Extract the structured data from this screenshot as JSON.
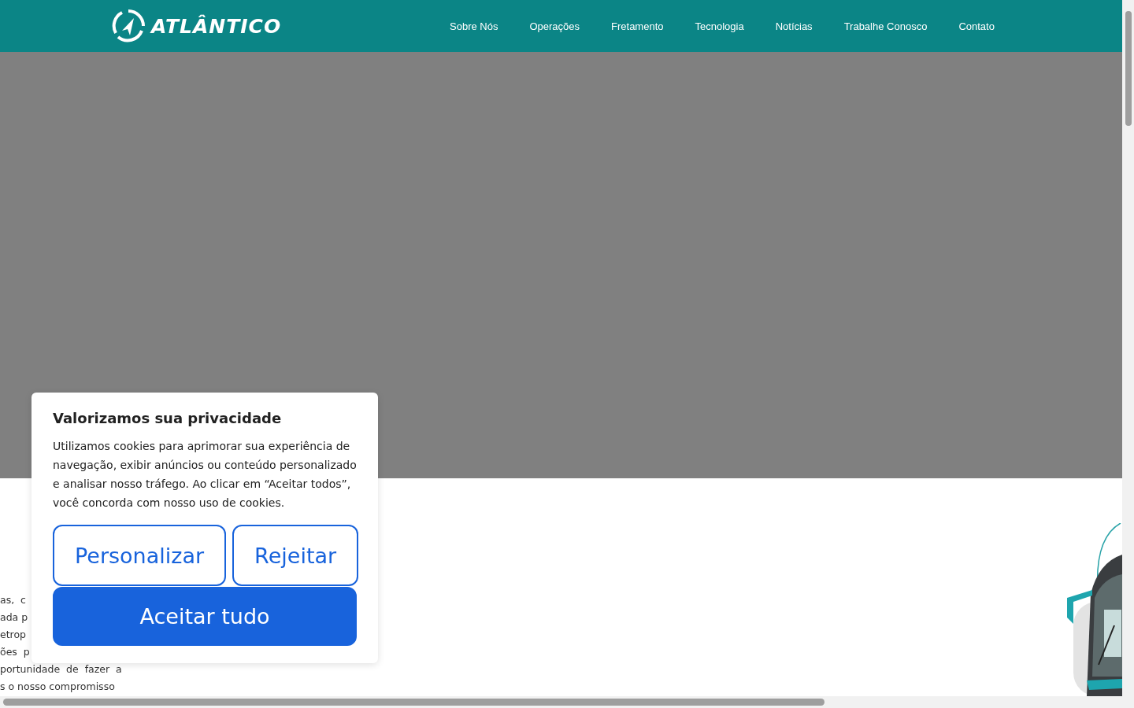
{
  "header": {
    "logo": "ATLÂNTICO",
    "nav": [
      "Sobre Nós",
      "Operações",
      "Fretamento",
      "Tecnologia",
      "Notícias",
      "Trabalhe Conosco",
      "Contato"
    ]
  },
  "hero": {
    "kind": "empty"
  },
  "intro": {
    "lines": [
      "as,  c",
      "ada p",
      "etrop",
      "ões  p",
      "portunidade  de  fazer  a",
      "s o nosso compromisso"
    ],
    "image": {
      "kind": "picture"
    }
  },
  "cookie_banner": {
    "title": "Valorizamos sua privacidade",
    "text": "Utilizamos cookies para aprimorar sua experiência de navegação, exibir anúncios ou conteúdo personalizado e analisar nosso tráfego. Ao clicar em “Aceitar todos”, você concorda com nosso uso de cookies.",
    "buttons": [
      {
        "label": "Personalizar",
        "kind": "outline"
      },
      {
        "label": "Rejeitar",
        "kind": "outline"
      },
      {
        "label": "Aceitar tudo",
        "kind": "primary"
      }
    ]
  }
}
